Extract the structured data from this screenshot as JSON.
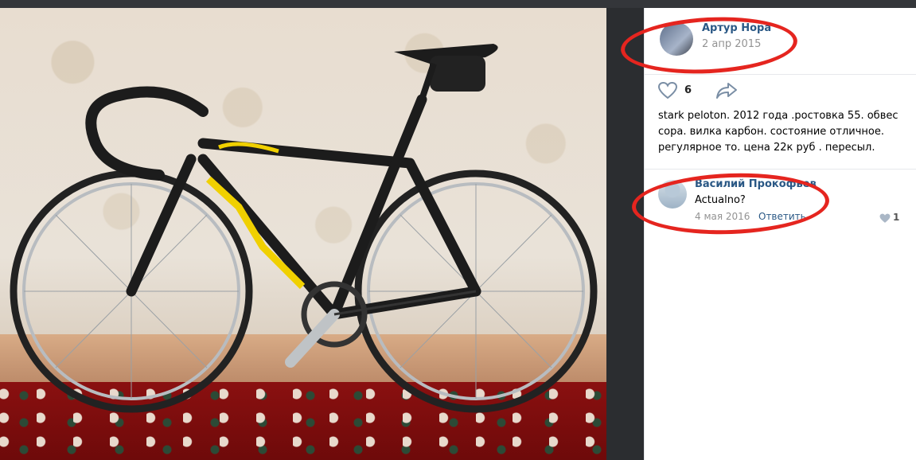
{
  "post": {
    "author_name": "Артур Нора",
    "date": "2 апр 2015",
    "likes": "6",
    "text": "stark peloton. 2012 года .ростовка 55. обвес сора. вилка карбон. состояние отличное. регулярное то. цена 22к руб . пересыл."
  },
  "comment": {
    "author_name": "Василий Прокофьев",
    "text": "Actualno?",
    "date": "4 мая 2016",
    "reply_label": "Ответить",
    "likes": "1"
  },
  "icons": {
    "like": "heart-icon",
    "share": "share-arrow-icon",
    "comment_like": "heart-small-icon"
  },
  "colors": {
    "link": "#2a5885",
    "muted": "#939393",
    "highlight": "#e5251f"
  }
}
